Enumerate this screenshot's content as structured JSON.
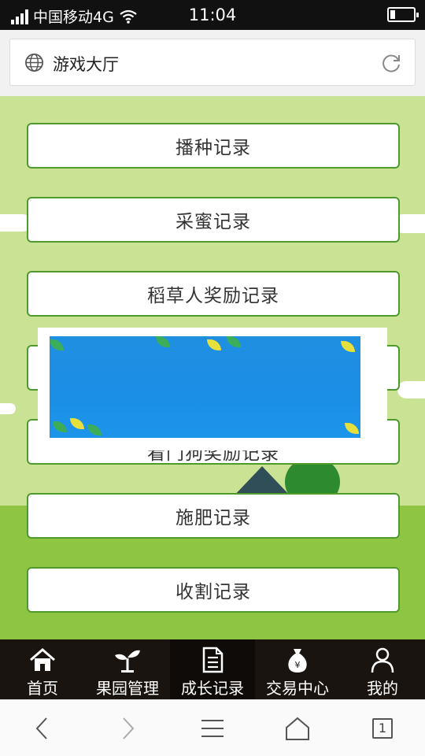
{
  "status_bar": {
    "carrier": "中国移动4G",
    "time": "11:04"
  },
  "address_bar": {
    "title": "游戏大厅"
  },
  "menu": {
    "items": [
      {
        "label": "播种记录"
      },
      {
        "label": "采蜜记录"
      },
      {
        "label": "稻草人奖励记录"
      },
      {
        "label": ""
      },
      {
        "label": "看门狗奖励记录"
      },
      {
        "label": "施肥记录"
      },
      {
        "label": "收割记录"
      }
    ]
  },
  "tabbar": {
    "items": [
      {
        "label": "首页",
        "icon": "home-icon"
      },
      {
        "label": "果园管理",
        "icon": "sprout-icon"
      },
      {
        "label": "成长记录",
        "icon": "document-icon",
        "active": true
      },
      {
        "label": "交易中心",
        "icon": "money-bag-icon"
      },
      {
        "label": "我的",
        "icon": "user-icon"
      }
    ]
  },
  "toolbar": {
    "tab_count": "1"
  },
  "colors": {
    "background": "#c9e293",
    "button_border": "#4f9a2c",
    "tabbar": "#1a1410",
    "ad_blue": "#1f8fe0"
  }
}
